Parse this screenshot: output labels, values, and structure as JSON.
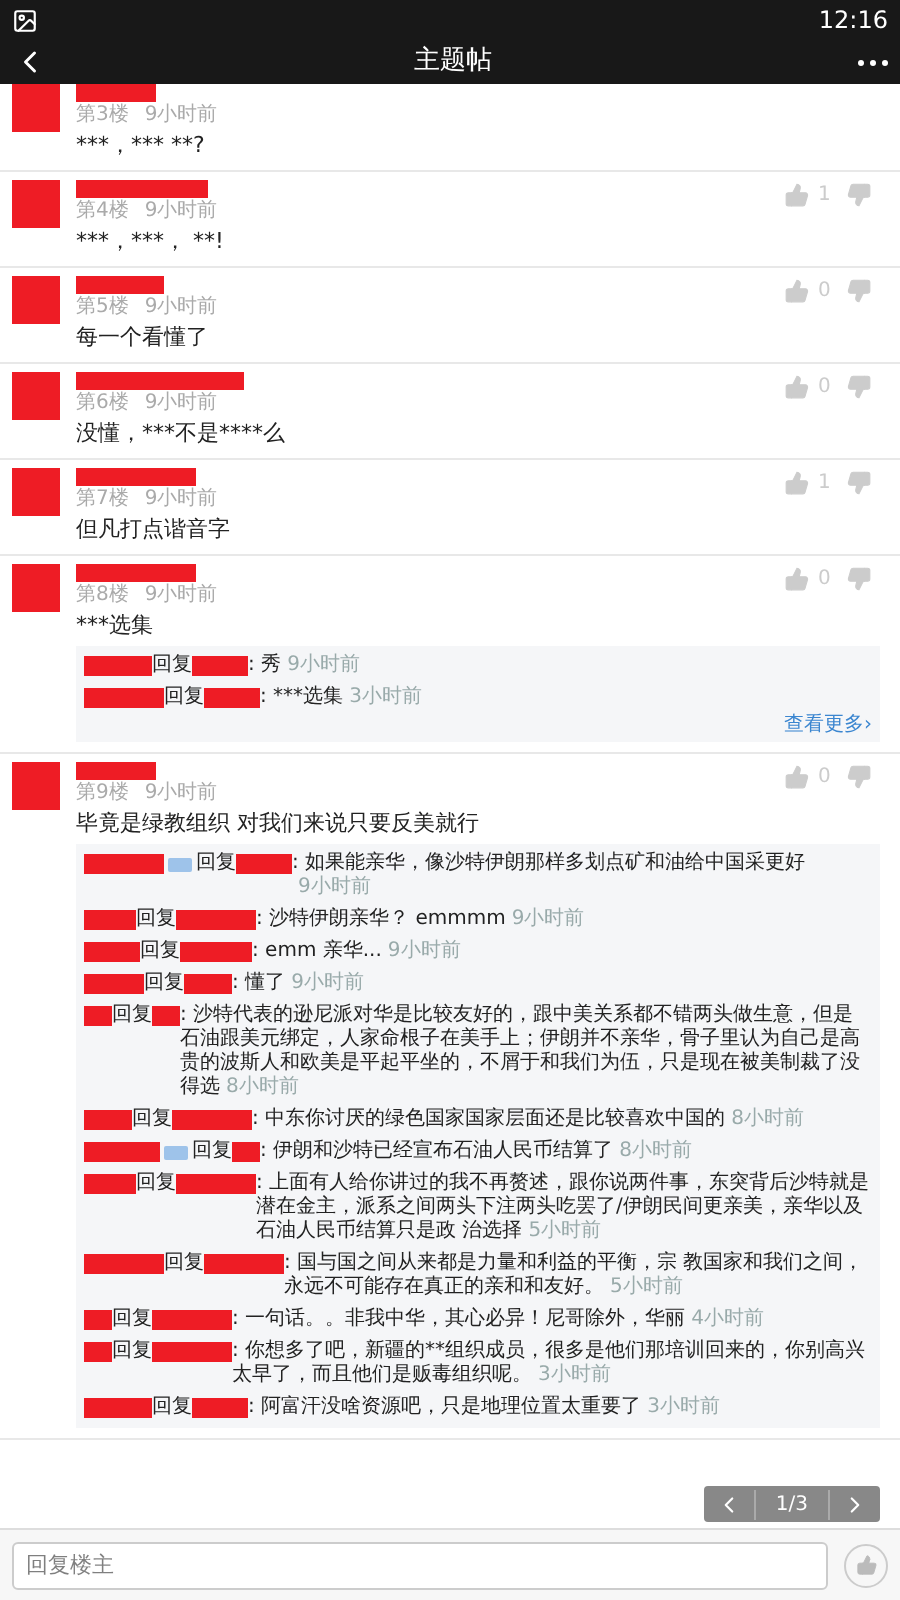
{
  "status_bar": {
    "time": "12:16"
  },
  "header": {
    "title": "主题帖"
  },
  "posts": [
    {
      "floor": "第3楼",
      "time": "9小时前",
      "text": "***，*** **?"
    },
    {
      "floor": "第4楼",
      "time": "9小时前",
      "text": "***，***， **!",
      "likes": "1"
    },
    {
      "floor": "第5楼",
      "time": "9小时前",
      "text": "每一个看懂了",
      "likes": "0"
    },
    {
      "floor": "第6楼",
      "time": "9小时前",
      "text": "没懂，***不是****么",
      "likes": "0"
    },
    {
      "floor": "第7楼",
      "time": "9小时前",
      "text": "但凡打点谐音字",
      "likes": "1"
    },
    {
      "floor": "第8楼",
      "time": "9小时前",
      "text": "***选集",
      "likes": "0",
      "more": "查看更多›",
      "replies": [
        {
          "badge": false,
          "reply_word": "回复",
          "text": ": 秀",
          "time": "9小时前"
        },
        {
          "badge": false,
          "reply_word": "回复",
          "text": ": ***选集",
          "time": "3小时前"
        }
      ]
    },
    {
      "floor": "第9楼",
      "time": "9小时前",
      "text": "毕竟是绿教组织 对我们来说只要反美就行",
      "likes": "0",
      "replies": [
        {
          "badge": true,
          "reply_word": "回复",
          "text": ": 如果能亲华，像沙特伊朗那样多划点矿和油给中国采更好",
          "time": "9小时前"
        },
        {
          "badge": false,
          "reply_word": "回复",
          "text": ": 沙特伊朗亲华？ emmmm",
          "time": "9小时前"
        },
        {
          "badge": false,
          "reply_word": "回复",
          "text": ": emm 亲华...",
          "time": "9小时前"
        },
        {
          "badge": false,
          "reply_word": "回复",
          "text": ": 懂了",
          "time": "9小时前"
        },
        {
          "badge": false,
          "reply_word": "回复",
          "text": ": 沙特代表的逊尼派对华是比较友好的，跟中美关系都不错两头做生意，但是石油跟美元绑定，人家命根子在美手上；伊朗并不亲华，骨子里认为自己是高贵的波斯人和欧美是平起平坐的，不屑于和我们为伍，只是现在被美制裁了没得选",
          "time": "8小时前"
        },
        {
          "badge": false,
          "reply_word": "回复",
          "text": ": 中东你讨厌的绿色国家国家层面还是比较喜欢中国的",
          "time": "8小时前"
        },
        {
          "badge": true,
          "reply_word": "回复",
          "text": ": 伊朗和沙特已经宣布石油人民币结算了",
          "time": "8小时前"
        },
        {
          "badge": false,
          "reply_word": "回复",
          "text": ": 上面有人给你讲过的我不再赘述，跟你说两件事，东突背后沙特就是潜在金主，派系之间两头下注两头吃罢了/伊朗民间更亲美，亲华以及石油人民币结算只是政 治选择",
          "time": "5小时前"
        },
        {
          "badge": false,
          "reply_word": "回复",
          "text": ": 国与国之间从来都是力量和利益的平衡，宗 教国家和我们之间，永远不可能存在真正的亲和和友好。",
          "time": "5小时前"
        },
        {
          "badge": false,
          "reply_word": "回复",
          "text": ": 一句话。。非我中华，其心必异！尼哥除外，华丽",
          "time": "4小时前"
        },
        {
          "badge": false,
          "reply_word": "回复",
          "text": ": 你想多了吧，新疆的**组织成员，很多是他们那培训回来的，你别高兴太早了，而且他们是贩毒组织呢。",
          "time": "3小时前"
        },
        {
          "badge": false,
          "reply_word": "回复",
          "text": ": 阿富汗没啥资源吧，只是地理位置太重要了",
          "time": "3小时前"
        }
      ]
    }
  ],
  "pager": {
    "page": "1/3"
  },
  "reply_bar": {
    "placeholder": "回复楼主"
  }
}
